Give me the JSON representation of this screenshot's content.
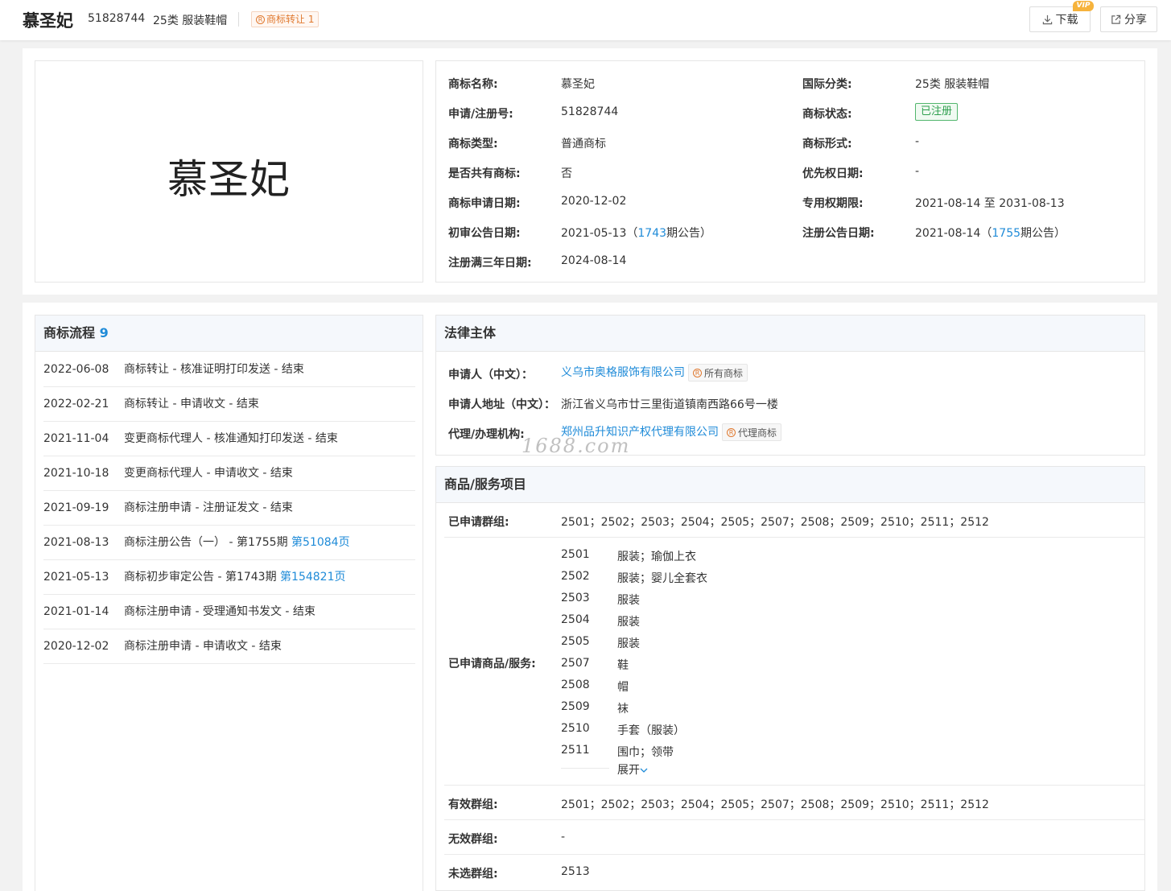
{
  "header": {
    "trademark_name": "慕圣妃",
    "reg_no": "51828744",
    "class_label": "25类 服装鞋帽",
    "transfer_tag": "商标转让 1",
    "download_label": "下载",
    "vip_badge": "VIP",
    "share_label": "分享"
  },
  "logo_text": "慕圣妃",
  "info": {
    "left": [
      {
        "label": "商标名称:",
        "value": "慕圣妃"
      },
      {
        "label": "申请/注册号:",
        "value": "51828744"
      },
      {
        "label": "商标类型:",
        "value": "普通商标"
      },
      {
        "label": "是否共有商标:",
        "value": "否"
      },
      {
        "label": "商标申请日期:",
        "value": "2020-12-02"
      },
      {
        "label": "初审公告日期:",
        "value_pre": "2021-05-13（",
        "value_link": "1743",
        "value_post": "期公告）"
      },
      {
        "label": "注册满三年日期:",
        "value": "2024-08-14"
      }
    ],
    "right": [
      {
        "label": "国际分类:",
        "value": "25类 服装鞋帽"
      },
      {
        "label": "商标状态:",
        "value": "已注册"
      },
      {
        "label": "商标形式:",
        "value": "-"
      },
      {
        "label": "优先权日期:",
        "value": "-"
      },
      {
        "label": "专用权期限:",
        "value": "2021-08-14 至 2031-08-13"
      },
      {
        "label": "注册公告日期:",
        "value_pre": "2021-08-14（",
        "value_link": "1755",
        "value_post": "期公告）"
      }
    ],
    "status_color": "#2e9f4e"
  },
  "flow": {
    "title": "商标流程",
    "count": "9",
    "items": [
      {
        "date": "2022-06-08",
        "desc": "商标转让 - 核准证明打印发送 - 结束",
        "link": ""
      },
      {
        "date": "2022-02-21",
        "desc": "商标转让 - 申请收文 - 结束",
        "link": ""
      },
      {
        "date": "2021-11-04",
        "desc": "变更商标代理人 - 核准通知打印发送 - 结束",
        "link": ""
      },
      {
        "date": "2021-10-18",
        "desc": "变更商标代理人 - 申请收文 - 结束",
        "link": ""
      },
      {
        "date": "2021-09-19",
        "desc": "商标注册申请 - 注册证发文 - 结束",
        "link": ""
      },
      {
        "date": "2021-08-13",
        "desc": "商标注册公告（一） - 第1755期 ",
        "link": "第51084页"
      },
      {
        "date": "2021-05-13",
        "desc": "商标初步审定公告 - 第1743期 ",
        "link": "第154821页"
      },
      {
        "date": "2021-01-14",
        "desc": "商标注册申请 - 受理通知书发文 - 结束",
        "link": ""
      },
      {
        "date": "2020-12-02",
        "desc": "商标注册申请 - 申请收文 - 结束",
        "link": ""
      }
    ]
  },
  "legal": {
    "title": "法律主体",
    "applicant_label": "申请人（中文）：",
    "applicant": "义乌市奥格服饰有限公司",
    "applicant_tag": "所有商标",
    "address_label": "申请人地址（中文）：",
    "address": "浙江省义乌市廿三里街道镇南西路66号一楼",
    "agent_label": "代理/办理机构:",
    "agent": "郑州品升知识产权代理有限公司",
    "agent_tag": "代理商标"
  },
  "watermark": "1688.com",
  "services": {
    "title": "商品/服务项目",
    "applied_groups_label": "已申请群组:",
    "applied_groups": "2501；2502；2503；2504；2505；2507；2508；2509；2510；2511；2512",
    "goods_label": "已申请商品/服务:",
    "goods": [
      {
        "code": "2501",
        "name": "服装；瑜伽上衣"
      },
      {
        "code": "2502",
        "name": "服装；婴儿全套衣"
      },
      {
        "code": "2503",
        "name": "服装"
      },
      {
        "code": "2504",
        "name": "服装"
      },
      {
        "code": "2505",
        "name": "服装"
      },
      {
        "code": "2507",
        "name": "鞋"
      },
      {
        "code": "2508",
        "name": "帽"
      },
      {
        "code": "2509",
        "name": "袜"
      },
      {
        "code": "2510",
        "name": "手套（服装）"
      },
      {
        "code": "2511",
        "name": "围巾；领带"
      }
    ],
    "expand_label": "展开",
    "valid_groups_label": "有效群组:",
    "valid_groups": "2501；2502；2503；2504；2505；2507；2508；2509；2510；2511；2512",
    "invalid_groups_label": "无效群组:",
    "invalid_groups": "-",
    "unselected_groups_label": "未选群组:",
    "unselected_groups": "2513"
  }
}
